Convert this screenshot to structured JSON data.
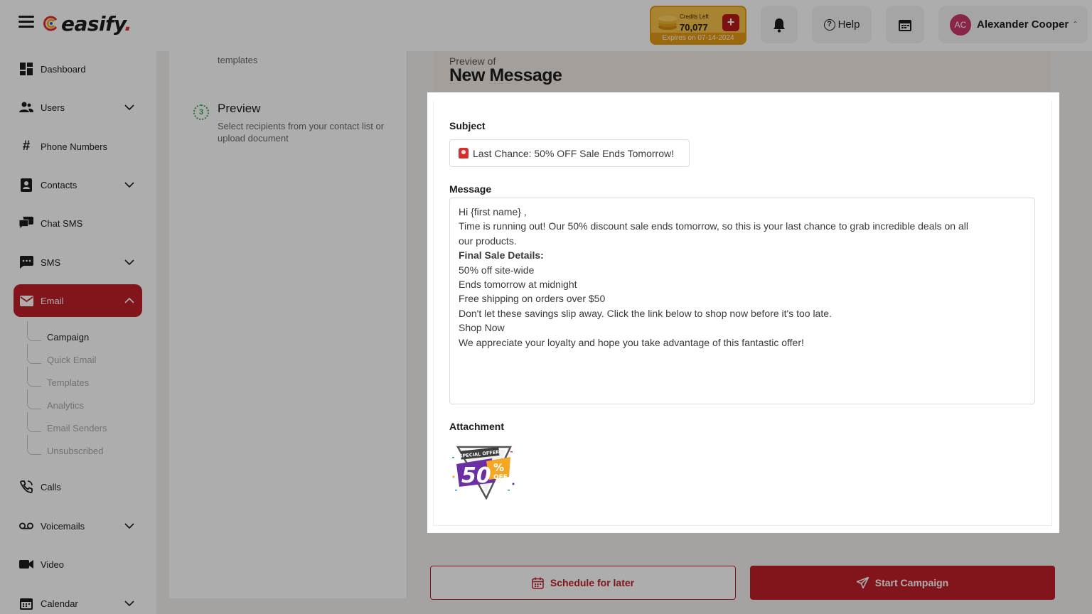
{
  "app": {
    "brand": "easify",
    "brand_dot": "."
  },
  "header": {
    "credits_label": "Credits Left",
    "credits_value": "70,077",
    "credits_add": "+",
    "credits_expiry": "Expires on 07-14-2024",
    "help_label": "Help",
    "user_initials": "AC",
    "user_name": "Alexander Cooper",
    "user_caret": "⌃"
  },
  "sidebar": {
    "items": [
      {
        "label": "Dashboard",
        "icon": "dashboard-icon"
      },
      {
        "label": "Users",
        "icon": "users-icon"
      },
      {
        "label": "Phone Numbers",
        "icon": "hash-icon"
      },
      {
        "label": "Contacts",
        "icon": "contacts-icon"
      },
      {
        "label": "Chat SMS",
        "icon": "chat-icon"
      },
      {
        "label": "SMS",
        "icon": "sms-icon"
      },
      {
        "label": "Email",
        "icon": "mail-icon"
      },
      {
        "label": "Calls",
        "icon": "phone-icon"
      },
      {
        "label": "Voicemails",
        "icon": "voicemail-icon"
      },
      {
        "label": "Video",
        "icon": "video-icon"
      },
      {
        "label": "Calendar",
        "icon": "calendar-icon"
      }
    ],
    "email_sub": [
      "Campaign",
      "Quick Email",
      "Templates",
      "Analytics",
      "Email Senders",
      "Unsubscribed"
    ]
  },
  "steps": {
    "prev_fragment": "templates",
    "current_number": "3",
    "current_title": "Preview",
    "current_desc": "Select recipients from your contact list or upload document"
  },
  "preview": {
    "preview_of": "Preview of",
    "title": "New Message",
    "subject_label": "Subject",
    "subject_value": "Last Chance: 50% OFF Sale Ends Tomorrow!",
    "message_label": "Message",
    "message_lines": [
      "Hi  {first name} ,",
      "Time is running out! Our 50% discount sale ends tomorrow, so this is your last chance to grab incredible deals on all",
      "our products.",
      "Final Sale Details:",
      "50% off site-wide",
      "Ends tomorrow at midnight",
      "Free shipping on orders over $50",
      "Don't let these savings slip away. Click the link below to shop now before it's too late.",
      "Shop Now",
      "We appreciate your loyalty and hope you take advantage of this fantastic offer!"
    ],
    "attachment_label": "Attachment",
    "attachment_banner": "SPECIAL OFFER",
    "attachment_big": "50",
    "attachment_pct": "%",
    "attachment_off": "OFF"
  },
  "actions": {
    "schedule_label": "Schedule for later",
    "start_label": "Start Campaign"
  },
  "colors": {
    "accent": "#c0202a",
    "credits_bg": "#f6c14a",
    "step_green": "#3aa84b"
  }
}
